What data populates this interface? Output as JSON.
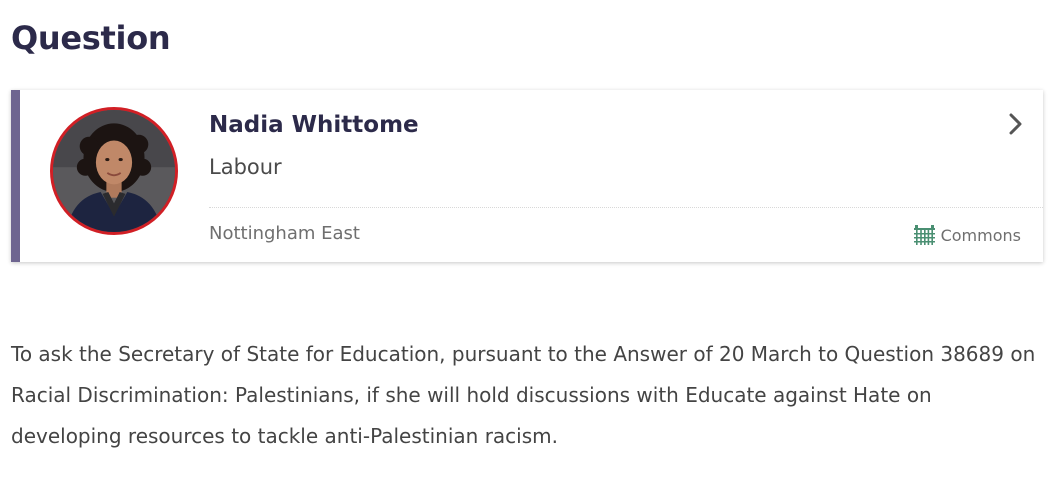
{
  "page": {
    "title": "Question"
  },
  "member": {
    "name": "Nadia Whittome",
    "party": "Labour",
    "constituency": "Nottingham East",
    "house": "Commons",
    "house_icon": "portcullis-icon",
    "party_color": "#d11f25",
    "accent_color": "#6e6590",
    "house_color": "#4a8f72"
  },
  "question": {
    "text": "To ask the Secretary of State for Education, pursuant to the Answer of 20 March to Question 38689 on Racial Discrimination: Palestinians, if she will hold discussions with Educate against Hate on developing resources to tackle anti-Palestinian racism."
  }
}
